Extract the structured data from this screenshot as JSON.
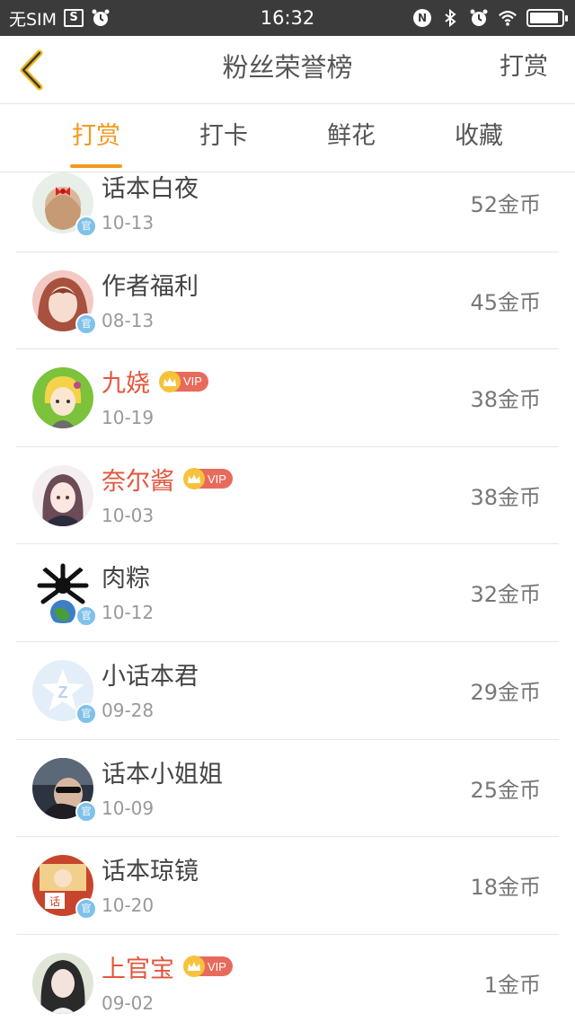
{
  "status_bar": {
    "carrier": "无SIM",
    "time": "16:32",
    "battery_level": 0.9
  },
  "nav": {
    "title": "粉丝荣誉榜",
    "right_action": "打赏",
    "back_icon": "chevron-left-icon"
  },
  "tabs": [
    {
      "label": "打赏",
      "active": true
    },
    {
      "label": "打卡",
      "active": false
    },
    {
      "label": "鲜花",
      "active": false
    },
    {
      "label": "收藏",
      "active": false
    }
  ],
  "colors": {
    "accent": "#f29a1e",
    "vip_name": "#e3553c",
    "vip_badge": "#e86a5c",
    "official_badge": "#7fc1ea"
  },
  "fans": [
    {
      "name": "话本白夜",
      "date": "10-13",
      "coins": "52金币",
      "vip": false,
      "official": true
    },
    {
      "name": "作者福利",
      "date": "08-13",
      "coins": "45金币",
      "vip": false,
      "official": true
    },
    {
      "name": "九娆",
      "date": "10-19",
      "coins": "38金币",
      "vip": true,
      "official": false
    },
    {
      "name": "奈尔酱",
      "date": "10-03",
      "coins": "38金币",
      "vip": true,
      "official": false
    },
    {
      "name": "肉粽",
      "date": "10-12",
      "coins": "32金币",
      "vip": false,
      "official": true
    },
    {
      "name": "小话本君",
      "date": "09-28",
      "coins": "29金币",
      "vip": false,
      "official": true
    },
    {
      "name": "话本小姐姐",
      "date": "10-09",
      "coins": "25金币",
      "vip": false,
      "official": true
    },
    {
      "name": "话本琼镜",
      "date": "10-20",
      "coins": "18金币",
      "vip": false,
      "official": true
    },
    {
      "name": "上官宝",
      "date": "09-02",
      "coins": "1金币",
      "vip": true,
      "official": false
    }
  ],
  "vip_label": "VIP"
}
